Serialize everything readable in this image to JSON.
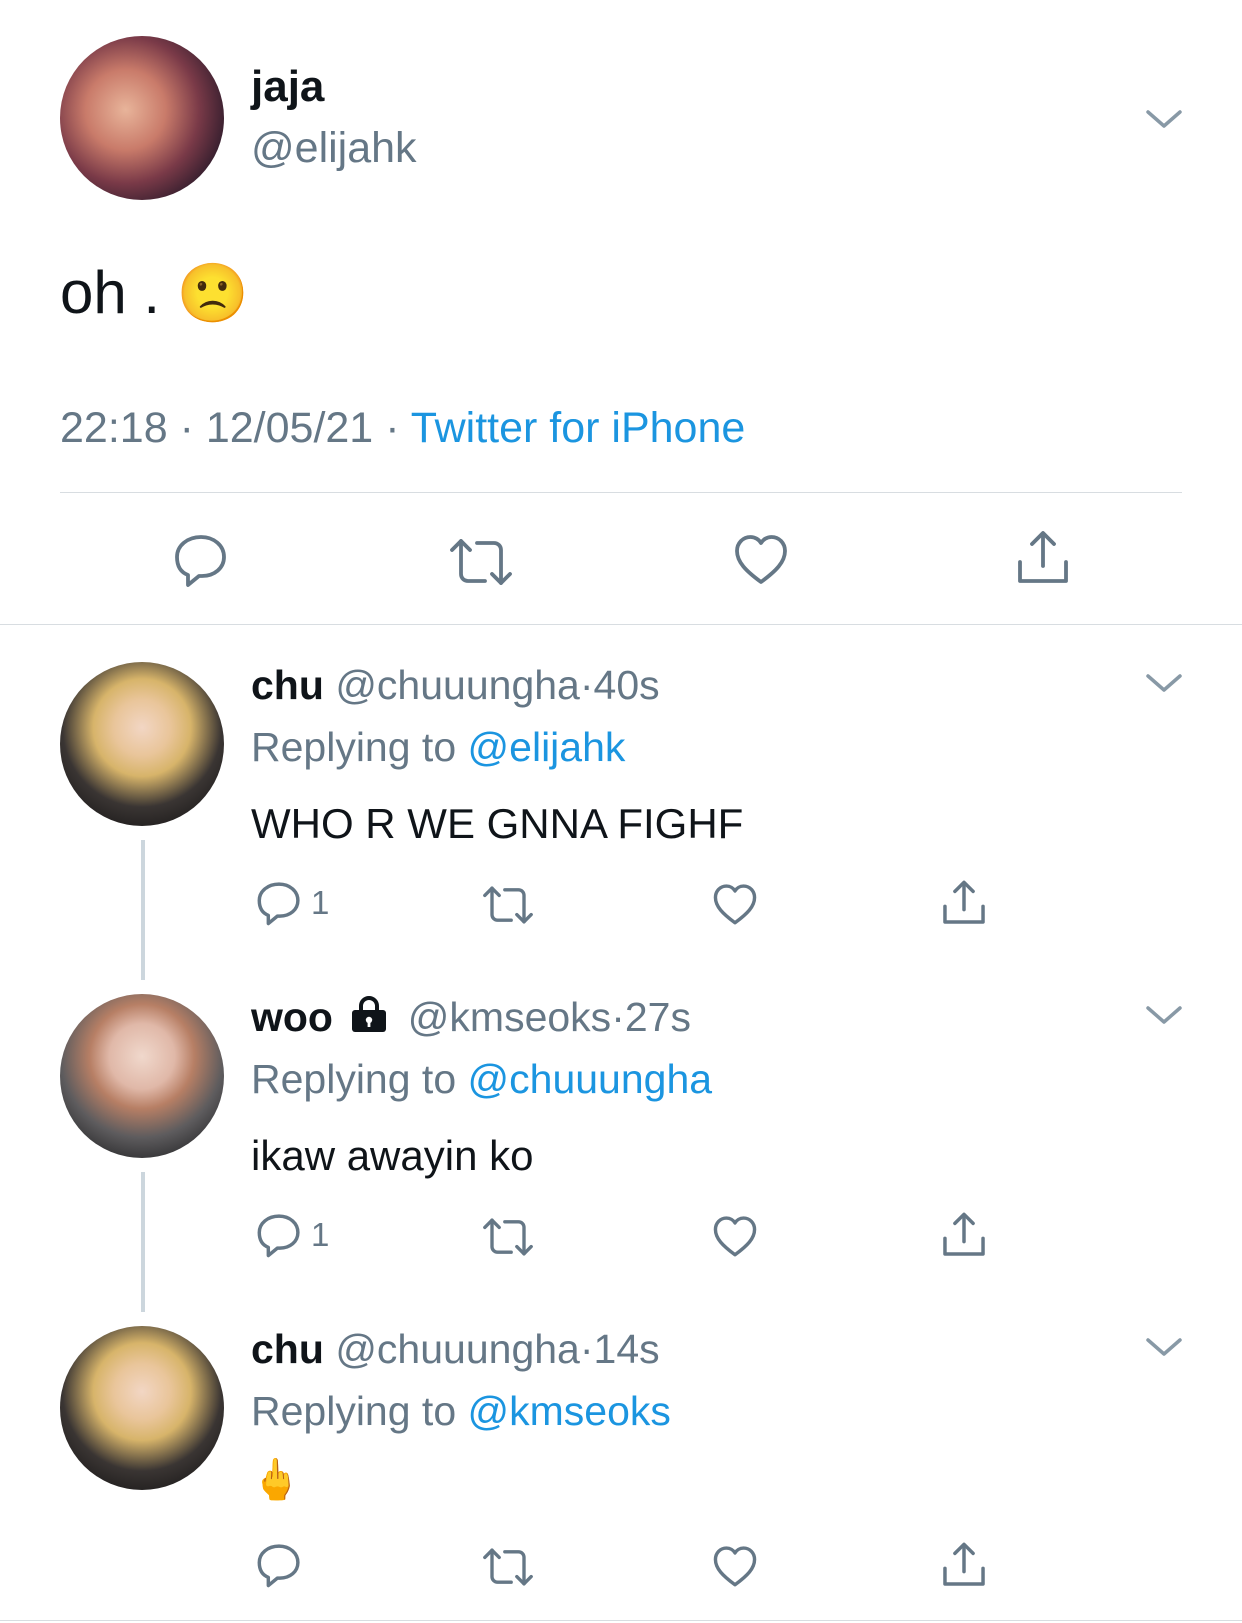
{
  "main_tweet": {
    "display_name": "jaja",
    "handle": "@elijahk",
    "text": "oh .",
    "emoji": "🙁",
    "time": "22:18",
    "date": "12/05/21",
    "source": "Twitter for iPhone",
    "sep": "·"
  },
  "replies": [
    {
      "display_name": "chu",
      "handle": "@chuuungha",
      "age": "40s",
      "replying_label": "Replying to",
      "replying_to": "@elijahk",
      "text": "WHO R WE GNNA FIGHF",
      "reply_count": "1"
    },
    {
      "display_name": "woo",
      "handle": "@kmseoks",
      "age": "27s",
      "replying_label": "Replying to",
      "replying_to": "@chuuungha",
      "text": "ikaw awayin ko",
      "reply_count": "1"
    },
    {
      "display_name": "chu",
      "handle": "@chuuungha",
      "age": "14s",
      "replying_label": "Replying to",
      "replying_to": "@kmseoks",
      "text": "🖕",
      "reply_count": ""
    }
  ],
  "icons": [
    "chevron-down-icon",
    "reply-icon",
    "retweet-icon",
    "like-icon",
    "share-icon",
    "lock-icon"
  ],
  "colors": {
    "link": "#1b95e0",
    "secondary": "#657786",
    "divider": "#d8dde1"
  }
}
